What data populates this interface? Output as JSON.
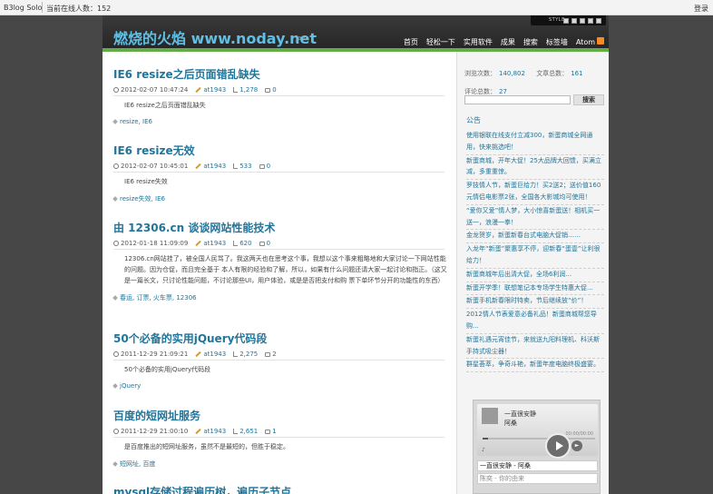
{
  "topbar": {
    "brand": "B3log Solo",
    "online": "当前在线人数：152",
    "login": "登录"
  },
  "header": {
    "title": "燃烧的火焰 www.noday.net",
    "subtitle": "Java",
    "style_label": "STYLE ·",
    "nav": [
      "首页",
      "轻松一下",
      "实用软件",
      "成果",
      "搜索",
      "标签墙",
      "Atom"
    ]
  },
  "articles": [
    {
      "title": "IE6 resize之后页面错乱缺失",
      "date": "2012-02-07 10:47:24",
      "author": "at1943",
      "views": "1,278",
      "comments": "0",
      "excerpt": "IE6 resize之后页面错乱缺失",
      "tags": "resize, IE6"
    },
    {
      "title": "IE6 resize无效",
      "date": "2012-02-07 10:45:01",
      "author": "at1943",
      "views": "533",
      "comments": "0",
      "excerpt": "IE6 resize失效",
      "tags": "resize失效, IE6"
    },
    {
      "title": "由 12306.cn 谈谈网站性能技术",
      "date": "2012-01-18 11:09:09",
      "author": "at1943",
      "views": "620",
      "comments": "0",
      "excerpt": "12306.cn网站挂了，被全国人民骂了。我这两天也在思考这个事，我想以这个事来粗略地和大家讨论一下网站性能的问题。因为仓促，而且完全基于 本人有限的经验和了解，所以，如果有什么问题还请大家一起讨论和指正。（这又是一篇长文，只讨论性能问题，不讨论那些UI，用户体验，或是是否把支付和购 票下单环节分开的功能性的东西）",
      "tags": "春运, 订票, 火车票, 12306"
    },
    {
      "title": "50个必备的实用jQuery代码段",
      "date": "2011-12-29 21:09:21",
      "author": "at1943",
      "views": "2,275",
      "comments": "2",
      "excerpt": "50个必备的实用jQuery代码段",
      "tags": "jQuery"
    },
    {
      "title": "百度的短网址服务",
      "date": "2011-12-29 21:00:10",
      "author": "at1943",
      "views": "2,651",
      "comments": "1",
      "excerpt": "是百度推出的短网址服务，虽然不是最短的，但胜于稳定。",
      "tags": "短网址, 百度"
    },
    {
      "title": "mysql存储过程遍历树，遍历子节点"
    }
  ],
  "sidebar": {
    "visits_label": "浏览次数：",
    "visits": "140,802",
    "articles_label": "文章总数：",
    "articles": "161",
    "comments_label": "评论总数：",
    "comments": "27",
    "search_button": "搜索",
    "notice_title": "公告",
    "notices": [
      "使用银联在线支付立减300，新蛋商城全网通用，快来挑选吧！",
      "新蛋商城，开年大促！25大品牌大回馈，买满立减，多重重惊。",
      "罗技情人节，新蛋巨给力！买2送2；送价值160元情侣电影票2张，全国各大影城均可使用！",
      "“爱你又爱”情人梦，大小惊喜新蛋送！相机买一送一，浪漫一拳！",
      "金龙贺岁，新蛋新春台式电脑大促销……",
      "入龙年“新蛋”聚惠享不停，迎新春“蛋壹”让利很给力！",
      "新蛋商城年后出清大促，全场6利润...",
      "新蛋开学季！联想笔记本专场学生特惠大促...",
      "新蛋手机新春限时特卖，节后继续放“价”！",
      "2012情人节表爱意必备礼品！新蛋商城帮您导购...",
      "新蛋礼遇元宵佳节，来就送九阳料理机、科沃斯手持式吸尘器！",
      "群星荟萃，争奇斗艳，新蛋年度电脑终极盛宴。"
    ],
    "player": {
      "song": "一直很安静",
      "artist": "阿桑",
      "time": "00:00/00:00",
      "playlist_item": "一直很安静 - 阿桑",
      "playlist_item2": "陈奕 - 你的由来",
      "progress": 0.05
    }
  }
}
